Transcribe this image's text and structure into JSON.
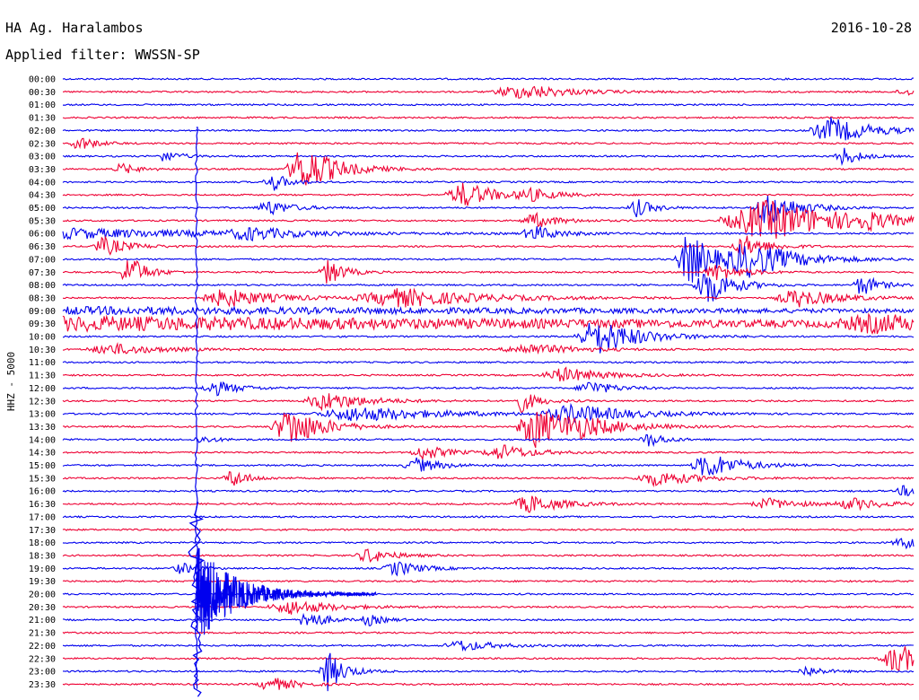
{
  "header": {
    "station": "HA Ag. Haralambos",
    "date": "2016-10-28",
    "filter": "Applied filter: WWSSN-SP"
  },
  "chart_data": {
    "type": "line",
    "title": "HA Ag. Haralambos",
    "subtitle": "Applied filter: WWSSN-SP",
    "ylabel": "HHZ - 5000",
    "time_labels": [
      "00:00",
      "00:30",
      "01:00",
      "01:30",
      "02:00",
      "02:30",
      "03:00",
      "03:30",
      "04:00",
      "04:30",
      "05:00",
      "05:30",
      "06:00",
      "06:30",
      "07:00",
      "07:30",
      "08:00",
      "08:30",
      "09:00",
      "09:30",
      "10:00",
      "10:30",
      "11:00",
      "11:30",
      "12:00",
      "12:30",
      "13:00",
      "13:30",
      "14:00",
      "14:30",
      "15:00",
      "15:30",
      "16:00",
      "16:30",
      "17:00",
      "17:30",
      "18:00",
      "18:30",
      "19:00",
      "19:30",
      "20:00",
      "20:30",
      "21:00",
      "21:30",
      "22:00",
      "22:30",
      "23:00",
      "23:30"
    ],
    "series_colors": [
      "#0000ee",
      "#ee0033"
    ],
    "grid": false,
    "large_event": {
      "onset_time": "20:00",
      "onset_offset_fraction": 0.157
    },
    "events": [
      [
        0.52,
        1,
        4,
        0.03
      ],
      [
        0.99,
        1,
        4,
        0.02
      ],
      [
        0.55,
        1,
        6,
        0.06
      ],
      [
        0.905,
        4,
        14,
        0.05
      ],
      [
        0.02,
        5,
        8,
        0.02
      ],
      [
        0.12,
        6,
        6,
        0.02
      ],
      [
        0.918,
        6,
        10,
        0.02
      ],
      [
        0.285,
        7,
        26,
        0.04
      ],
      [
        0.07,
        7,
        6,
        0.02
      ],
      [
        0.247,
        8,
        10,
        0.02
      ],
      [
        0.473,
        9,
        14,
        0.04
      ],
      [
        0.55,
        9,
        6,
        0.03
      ],
      [
        0.243,
        10,
        8,
        0.03
      ],
      [
        0.675,
        10,
        10,
        0.02
      ],
      [
        0.83,
        10,
        20,
        0.035
      ],
      [
        0.555,
        11,
        8,
        0.03
      ],
      [
        0.83,
        11,
        22,
        0.1
      ],
      [
        0.945,
        11,
        6,
        0.02
      ],
      [
        0.555,
        12,
        8,
        0.03
      ],
      [
        0.0,
        12,
        6,
        0.2
      ],
      [
        0.22,
        12,
        6,
        0.05
      ],
      [
        0.05,
        13,
        10,
        0.03
      ],
      [
        0.802,
        13,
        12,
        0.03
      ],
      [
        0.737,
        14,
        30,
        0.03
      ],
      [
        0.81,
        14,
        18,
        0.06
      ],
      [
        0.078,
        15,
        20,
        0.02
      ],
      [
        0.313,
        15,
        14,
        0.02
      ],
      [
        0.77,
        15,
        10,
        0.03
      ],
      [
        0.758,
        16,
        22,
        0.03
      ],
      [
        0.94,
        16,
        12,
        0.02
      ],
      [
        0.194,
        17,
        10,
        0.06
      ],
      [
        0.4,
        17,
        10,
        0.1
      ],
      [
        0.865,
        17,
        10,
        0.05
      ],
      [
        0.0,
        18,
        4,
        1.0
      ],
      [
        0.0,
        19,
        8,
        1.0
      ],
      [
        0.96,
        19,
        8,
        0.1
      ],
      [
        0.63,
        20,
        20,
        0.05
      ],
      [
        0.06,
        21,
        6,
        0.06
      ],
      [
        0.548,
        21,
        6,
        0.06
      ],
      [
        0.59,
        23,
        8,
        0.05
      ],
      [
        0.18,
        24,
        8,
        0.03
      ],
      [
        0.62,
        24,
        8,
        0.03
      ],
      [
        0.31,
        25,
        10,
        0.05
      ],
      [
        0.54,
        25,
        12,
        0.02
      ],
      [
        0.35,
        26,
        8,
        0.1
      ],
      [
        0.6,
        26,
        10,
        0.07
      ],
      [
        0.268,
        27,
        22,
        0.04
      ],
      [
        0.556,
        27,
        24,
        0.04
      ],
      [
        0.61,
        27,
        8,
        0.06
      ],
      [
        0.163,
        28,
        4,
        0.02
      ],
      [
        0.69,
        28,
        8,
        0.02
      ],
      [
        0.425,
        29,
        8,
        0.03
      ],
      [
        0.517,
        29,
        8,
        0.04
      ],
      [
        0.417,
        30,
        8,
        0.03
      ],
      [
        0.76,
        30,
        14,
        0.04
      ],
      [
        0.2,
        31,
        10,
        0.02
      ],
      [
        0.7,
        31,
        8,
        0.05
      ],
      [
        0.99,
        32,
        6,
        0.02
      ],
      [
        0.55,
        33,
        10,
        0.04
      ],
      [
        0.83,
        33,
        6,
        0.04
      ],
      [
        0.93,
        33,
        6,
        0.04
      ],
      [
        0.99,
        36,
        6,
        0.03
      ],
      [
        0.36,
        37,
        8,
        0.03
      ],
      [
        0.393,
        38,
        8,
        0.03
      ],
      [
        0.14,
        38,
        6,
        0.02
      ],
      [
        0.27,
        41,
        8,
        0.05
      ],
      [
        0.288,
        42,
        12,
        0.02
      ],
      [
        0.36,
        42,
        6,
        0.02
      ],
      [
        0.47,
        44,
        6,
        0.04
      ],
      [
        0.982,
        45,
        16,
        0.04
      ],
      [
        0.312,
        46,
        22,
        0.02
      ],
      [
        0.875,
        46,
        6,
        0.02
      ],
      [
        0.245,
        47,
        8,
        0.03
      ]
    ]
  }
}
